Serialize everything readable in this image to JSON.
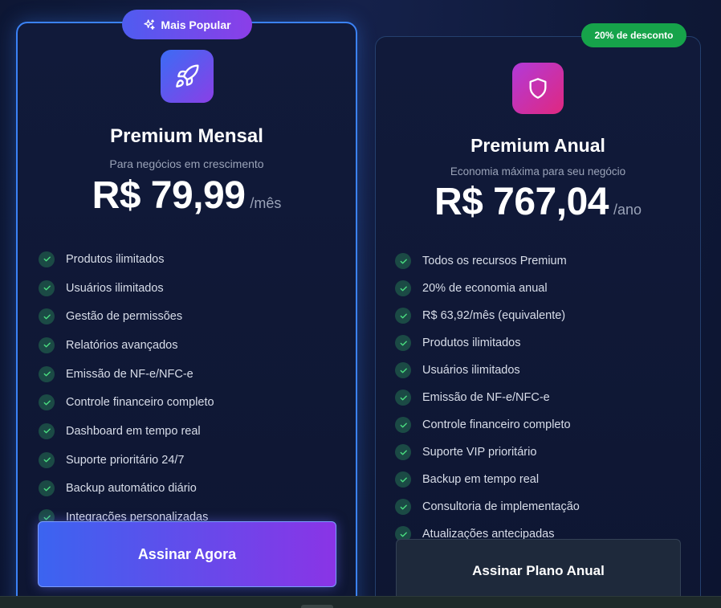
{
  "monthly": {
    "badge": "Mais Popular",
    "icon": "rocket-icon",
    "title": "Premium Mensal",
    "subtitle": "Para negócios em crescimento",
    "price": "R$ 79,99",
    "period": "/mês",
    "features": [
      "Produtos ilimitados",
      "Usuários ilimitados",
      "Gestão de permissões",
      "Relatórios avançados",
      "Emissão de NF-e/NFC-e",
      "Controle financeiro completo",
      "Dashboard em tempo real",
      "Suporte prioritário 24/7",
      "Backup automático diário",
      "Integrações personalizadas"
    ],
    "button_label": "Assinar Agora"
  },
  "annual": {
    "badge": "20% de desconto",
    "icon": "shield-icon",
    "title": "Premium Anual",
    "subtitle": "Economia máxima para seu negócio",
    "price": "R$ 767,04",
    "period": "/ano",
    "features": [
      "Todos os recursos Premium",
      "20% de economia anual",
      "R$ 63,92/mês (equivalente)",
      "Produtos ilimitados",
      "Usuários ilimitados",
      "Emissão de NF-e/NFC-e",
      "Controle financeiro completo",
      "Suporte VIP prioritário",
      "Backup em tempo real",
      "Consultoria de implementação",
      "Atualizações antecipadas"
    ],
    "button_label": "Assinar Plano Anual"
  },
  "colors": {
    "accent_blue": "#3b82f6",
    "accent_purple": "#8a34e6",
    "discount_green": "#16a34a",
    "check_bg": "#1b4a45",
    "check_mark": "#4ade80"
  }
}
